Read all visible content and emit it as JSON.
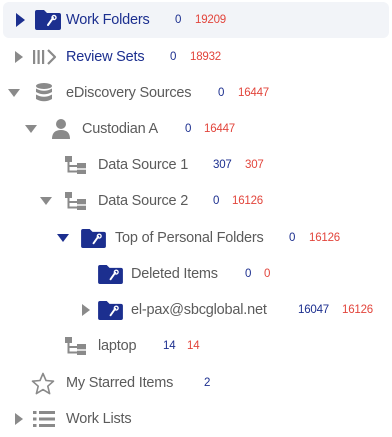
{
  "tree": {
    "work_folders": {
      "label": "Work Folders",
      "count": "0",
      "total": "19209"
    },
    "review_sets": {
      "label": "Review Sets",
      "count": "0",
      "total": "18932"
    },
    "ediscovery_sources": {
      "label": "eDiscovery Sources",
      "count": "0",
      "total": "16447"
    },
    "custodian_a": {
      "label": "Custodian A",
      "count": "0",
      "total": "16447"
    },
    "data_source_1": {
      "label": "Data Source 1",
      "count": "307",
      "total": "307"
    },
    "data_source_2": {
      "label": "Data Source 2",
      "count": "0",
      "total": "16126"
    },
    "top_personal_folders": {
      "label": "Top of Personal Folders",
      "count": "0",
      "total": "16126"
    },
    "deleted_items": {
      "label": "Deleted Items",
      "count": "0",
      "total": "0"
    },
    "el_pax": {
      "label": "el-pax@sbcglobal.net",
      "count": "16047",
      "total": "16126"
    },
    "laptop": {
      "label": "laptop",
      "count": "14",
      "total": "14"
    },
    "starred": {
      "label": "My Starred Items",
      "count": "2"
    },
    "work_lists": {
      "label": "Work Lists"
    }
  },
  "colors": {
    "navy": "#1c2f8f",
    "count_red": "#e2453c",
    "gray_label": "#5b5b5b",
    "icon_gray": "#8a8a8a",
    "selected_bg": "#f2f4f8"
  },
  "icons": {
    "folder_wrench": "folder-wrench-icon",
    "review_sets": "review-sets-icon",
    "database": "database-icon",
    "person": "person-icon",
    "hierarchy": "hierarchy-icon",
    "star": "star-outline-icon",
    "list": "list-icon",
    "expanded": "caret-down-icon",
    "collapsed": "caret-right-icon"
  }
}
